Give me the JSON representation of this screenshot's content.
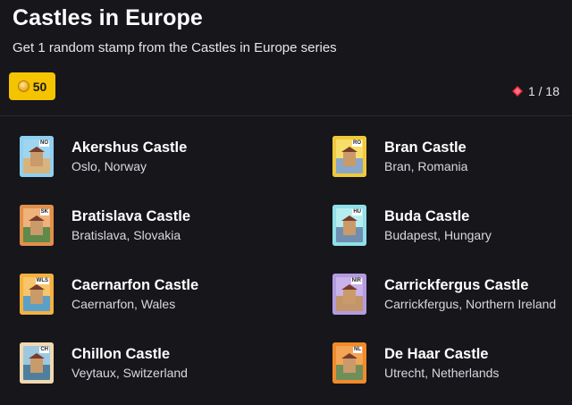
{
  "header": {
    "title": "Castles in Europe",
    "subtitle": "Get 1 random stamp from the Castles in Europe series",
    "price": "50",
    "counter": "1 / 18"
  },
  "colors": {
    "accent": "#f5c400",
    "background": "#16161b",
    "gem": "#e0263e"
  },
  "items": [
    {
      "name": "Akershus Castle",
      "location": "Oslo, Norway",
      "code": "NO",
      "frame": "#8fd0f0",
      "sky": "#9fd6ef",
      "ground": "#d9b37c"
    },
    {
      "name": "Bran Castle",
      "location": "Bran, Romania",
      "code": "RO",
      "frame": "#f0c93a",
      "sky": "#f7de6a",
      "ground": "#8aa6c8"
    },
    {
      "name": "Bratislava Castle",
      "location": "Bratislava, Slovakia",
      "code": "SK",
      "frame": "#e0904a",
      "sky": "#f0b27a",
      "ground": "#5f8a4a"
    },
    {
      "name": "Buda Castle",
      "location": "Budapest, Hungary",
      "code": "HU",
      "frame": "#8fe0e8",
      "sky": "#b6eef0",
      "ground": "#6f8fb0"
    },
    {
      "name": "Caernarfon Castle",
      "location": "Caernarfon, Wales",
      "code": "WLS",
      "frame": "#f5b040",
      "sky": "#f7c56a",
      "ground": "#5aa0c8"
    },
    {
      "name": "Carrickfergus Castle",
      "location": "Carrickfergus, Northern Ireland",
      "code": "NIR",
      "frame": "#b49be0",
      "sky": "#c9b3ea",
      "ground": "#c2966a"
    },
    {
      "name": "Chillon Castle",
      "location": "Veytaux, Switzerland",
      "code": "CH",
      "frame": "#f0d9b0",
      "sky": "#9ec8df",
      "ground": "#4f7f9f"
    },
    {
      "name": "De Haar Castle",
      "location": "Utrecht, Netherlands",
      "code": "NL",
      "frame": "#f08a2a",
      "sky": "#f3a555",
      "ground": "#6f8f5a"
    }
  ]
}
